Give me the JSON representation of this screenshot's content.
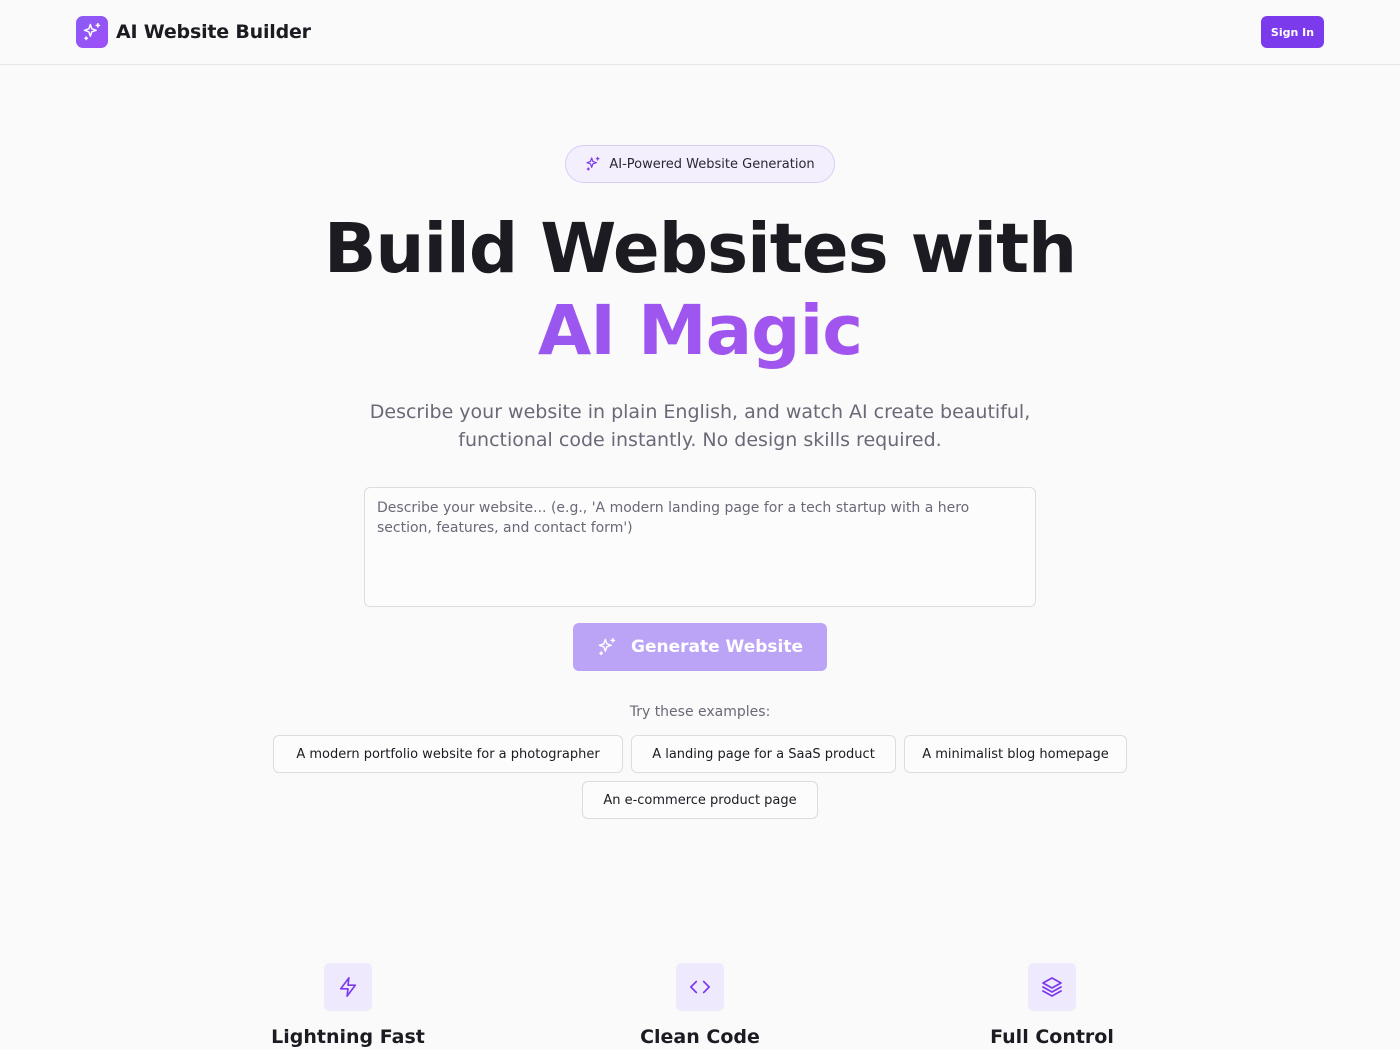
{
  "header": {
    "brand_name": "AI Website Builder",
    "signin_label": "Sign In"
  },
  "hero": {
    "badge": "AI-Powered Website Generation",
    "title_line1": "Build Websites with",
    "title_line2": "AI Magic",
    "subtitle": "Describe your website in plain English, and watch AI create beautiful, functional code instantly. No design skills required."
  },
  "prompt": {
    "value": "",
    "placeholder": "Describe your website... (e.g., 'A modern landing page for a tech startup with a hero section, features, and contact form')"
  },
  "generate_label": "Generate Website",
  "examples": {
    "label": "Try these examples:",
    "items": [
      "A modern portfolio website for a photographer",
      "A landing page for a SaaS product",
      "A minimalist blog homepage",
      "An e-commerce product page"
    ]
  },
  "features": [
    {
      "title": "Lightning Fast",
      "icon": "lightning-icon"
    },
    {
      "title": "Clean Code",
      "icon": "code-icon"
    },
    {
      "title": "Full Control",
      "icon": "layers-icon"
    }
  ],
  "colors": {
    "accent": "#7c3aed",
    "accent_soft": "#bba4f6",
    "gradient_start": "#8b5cf6",
    "gradient_end": "#b24fe8",
    "background": "#fafafa"
  }
}
